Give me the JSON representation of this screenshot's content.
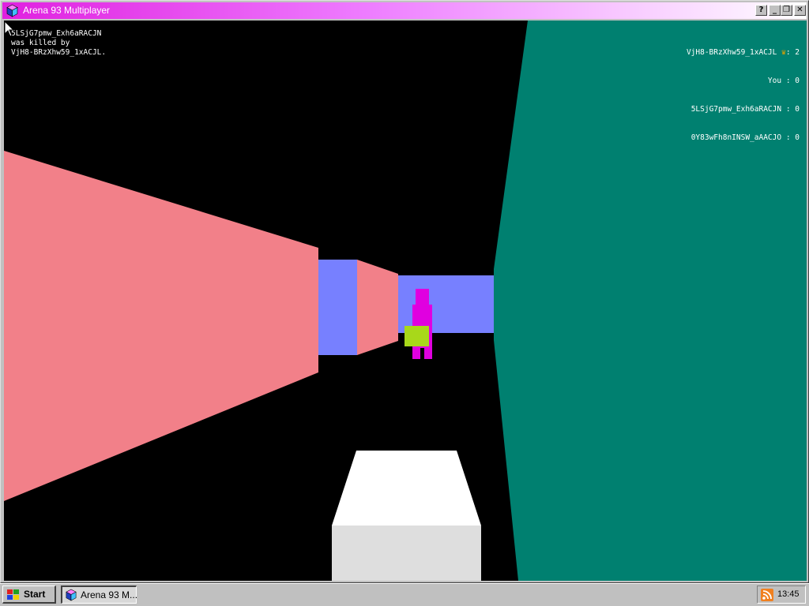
{
  "window": {
    "title": "Arena 93 Multiplayer",
    "buttons": {
      "help": "?",
      "minimize": "_",
      "restore": "❐",
      "close": "✕"
    },
    "title_gradient": [
      "#e020e0",
      "#ffffff"
    ]
  },
  "hud": {
    "killfeed": {
      "victim": "5LSjG7pmw_Exh6aRACJN",
      "verb": "was killed by",
      "killer": "VjH8-BRzXhw59_1xACJL."
    },
    "scoreboard": [
      {
        "name": "VjH8-BRzXhw59_1xACJL",
        "leader": true,
        "score": "2"
      },
      {
        "name": "You",
        "leader": false,
        "score": "0"
      },
      {
        "name": "5LSjG7pmw_Exh6aRACJN",
        "leader": false,
        "score": "0"
      },
      {
        "name": "0Y83wFh8nINSW_aAACJO",
        "leader": false,
        "score": "0"
      }
    ],
    "score_separator": " : ",
    "leader_separator": ": "
  },
  "scene_colors": {
    "left_wall": "#f28089",
    "corridor_side": "#7780ff",
    "right_wall": "#008070",
    "enemy": "#e000e0",
    "item": "#a8d81a",
    "weapon_top": "#ffffff",
    "weapon_front": "#dedede"
  },
  "taskbar": {
    "start_label": "Start",
    "task_label": "Arena 93 M...",
    "clock": "13:45"
  }
}
